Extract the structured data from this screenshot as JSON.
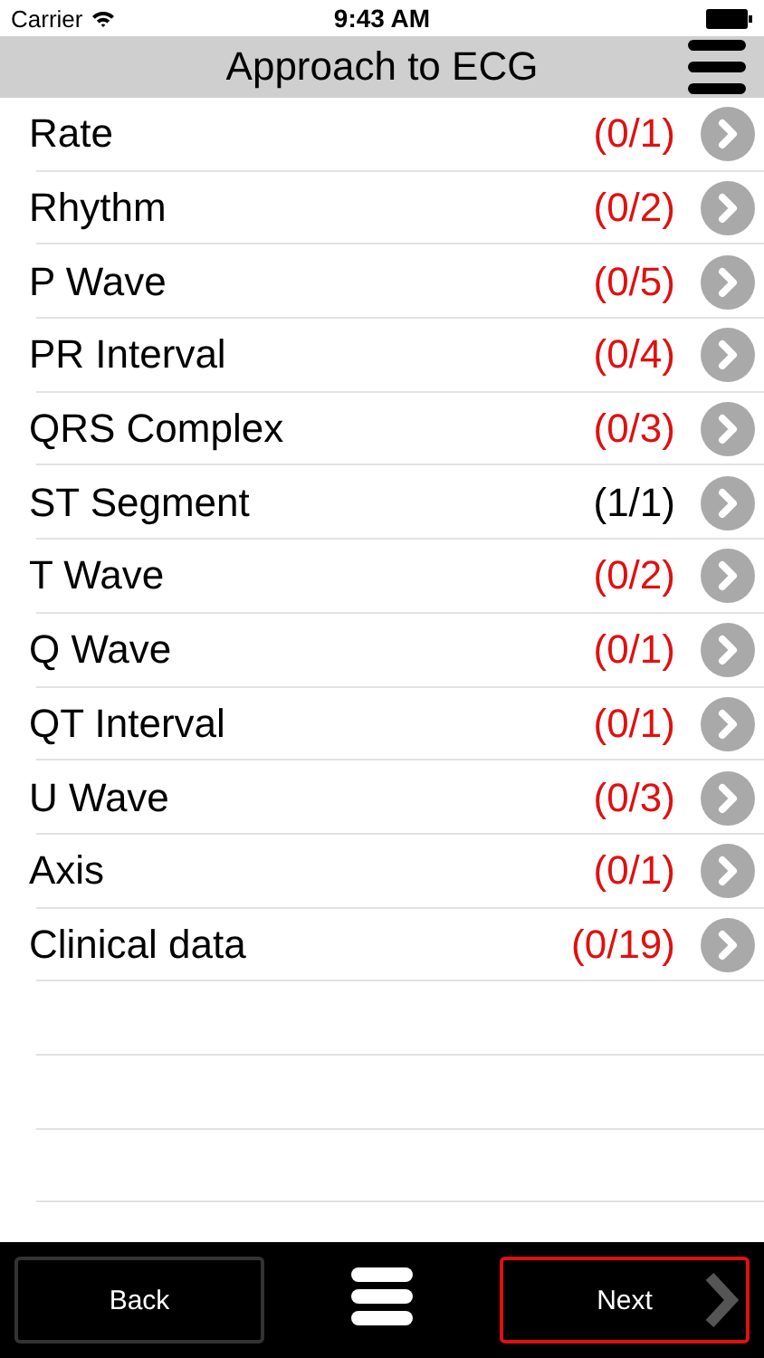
{
  "status_bar": {
    "carrier": "Carrier",
    "time": "9:43 AM"
  },
  "nav_bar": {
    "title": "Approach to ECG"
  },
  "topics": [
    {
      "name": "Rate",
      "score": "(0/1)",
      "completed": false
    },
    {
      "name": "Rhythm",
      "score": "(0/2)",
      "completed": false
    },
    {
      "name": "P Wave",
      "score": "(0/5)",
      "completed": false
    },
    {
      "name": "PR Interval",
      "score": "(0/4)",
      "completed": false
    },
    {
      "name": "QRS Complex",
      "score": "(0/3)",
      "completed": false
    },
    {
      "name": "ST Segment",
      "score": "(1/1)",
      "completed": true
    },
    {
      "name": "T Wave",
      "score": "(0/2)",
      "completed": false
    },
    {
      "name": "Q Wave",
      "score": "(0/1)",
      "completed": false
    },
    {
      "name": "QT Interval",
      "score": "(0/1)",
      "completed": false
    },
    {
      "name": "U Wave",
      "score": "(0/3)",
      "completed": false
    },
    {
      "name": "Axis",
      "score": "(0/1)",
      "completed": false
    },
    {
      "name": "Clinical data",
      "score": "(0/19)",
      "completed": false
    }
  ],
  "bottom_bar": {
    "back": {
      "label": "Back",
      "highlighted": false
    },
    "next": {
      "label": "Next",
      "highlighted": true
    }
  }
}
